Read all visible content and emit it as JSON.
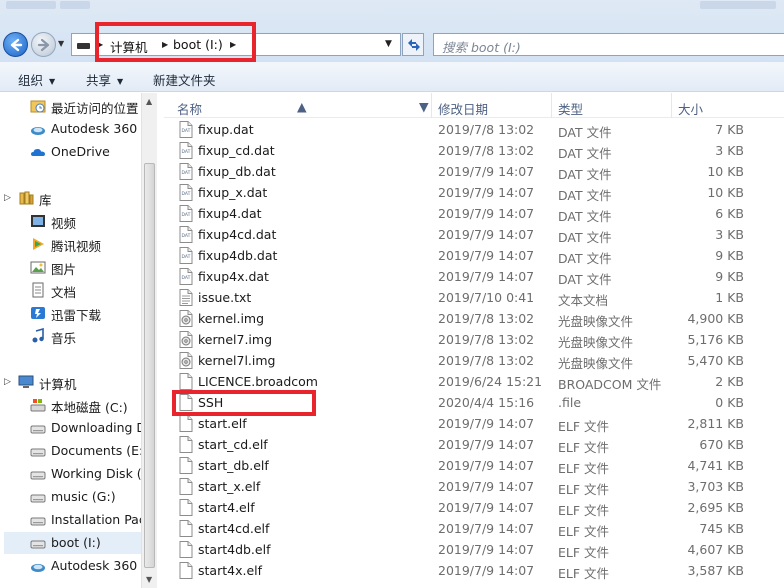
{
  "address": {
    "crumbs": [
      "计算机",
      "boot (I:)"
    ],
    "search_placeholder": "搜索 boot (I:)"
  },
  "toolbar": {
    "organize": "组织",
    "share": "共享",
    "new_folder": "新建文件夹"
  },
  "nav": {
    "items": [
      {
        "label": "最近访问的位置",
        "icon": "recent-places-icon"
      },
      {
        "label": "Autodesk 360",
        "icon": "autodesk-360-icon"
      },
      {
        "label": "OneDrive",
        "icon": "onedrive-cloud-icon"
      },
      {
        "label": "库",
        "icon": "library-icon"
      },
      {
        "label": "视频",
        "icon": "video-library-icon"
      },
      {
        "label": "腾讯视频",
        "icon": "tencent-video-icon"
      },
      {
        "label": "图片",
        "icon": "pictures-library-icon"
      },
      {
        "label": "文档",
        "icon": "documents-library-icon"
      },
      {
        "label": "迅雷下载",
        "icon": "thunder-download-icon"
      },
      {
        "label": "音乐",
        "icon": "music-library-icon"
      },
      {
        "label": "计算机",
        "icon": "computer-icon"
      },
      {
        "label": "本地磁盘 (C:)",
        "icon": "system-drive-icon"
      },
      {
        "label": "Downloading D",
        "icon": "drive-icon"
      },
      {
        "label": "Documents (E:)",
        "icon": "drive-icon"
      },
      {
        "label": "Working Disk (",
        "icon": "drive-icon"
      },
      {
        "label": "music (G:)",
        "icon": "drive-icon"
      },
      {
        "label": "Installation Pacl",
        "icon": "drive-icon"
      },
      {
        "label": "boot (I:)",
        "icon": "drive-icon",
        "selected": true
      },
      {
        "label": "Autodesk 360",
        "icon": "autodesk-360-icon"
      }
    ]
  },
  "columns": {
    "name": "名称",
    "date": "修改日期",
    "type": "类型",
    "size": "大小"
  },
  "files": [
    {
      "name": "fixup.dat",
      "date": "2019/7/8 13:02",
      "type": "DAT 文件",
      "size": "7 KB",
      "icon": "dat-file-icon"
    },
    {
      "name": "fixup_cd.dat",
      "date": "2019/7/8 13:02",
      "type": "DAT 文件",
      "size": "3 KB",
      "icon": "dat-file-icon"
    },
    {
      "name": "fixup_db.dat",
      "date": "2019/7/9 14:07",
      "type": "DAT 文件",
      "size": "10 KB",
      "icon": "dat-file-icon"
    },
    {
      "name": "fixup_x.dat",
      "date": "2019/7/9 14:07",
      "type": "DAT 文件",
      "size": "10 KB",
      "icon": "dat-file-icon"
    },
    {
      "name": "fixup4.dat",
      "date": "2019/7/9 14:07",
      "type": "DAT 文件",
      "size": "6 KB",
      "icon": "dat-file-icon"
    },
    {
      "name": "fixup4cd.dat",
      "date": "2019/7/9 14:07",
      "type": "DAT 文件",
      "size": "3 KB",
      "icon": "dat-file-icon"
    },
    {
      "name": "fixup4db.dat",
      "date": "2019/7/9 14:07",
      "type": "DAT 文件",
      "size": "9 KB",
      "icon": "dat-file-icon"
    },
    {
      "name": "fixup4x.dat",
      "date": "2019/7/9 14:07",
      "type": "DAT 文件",
      "size": "9 KB",
      "icon": "dat-file-icon"
    },
    {
      "name": "issue.txt",
      "date": "2019/7/10 0:41",
      "type": "文本文档",
      "size": "1 KB",
      "icon": "text-file-icon"
    },
    {
      "name": "kernel.img",
      "date": "2019/7/8 13:02",
      "type": "光盘映像文件",
      "size": "4,900 KB",
      "icon": "disc-image-icon"
    },
    {
      "name": "kernel7.img",
      "date": "2019/7/8 13:02",
      "type": "光盘映像文件",
      "size": "5,176 KB",
      "icon": "disc-image-icon"
    },
    {
      "name": "kernel7l.img",
      "date": "2019/7/8 13:02",
      "type": "光盘映像文件",
      "size": "5,470 KB",
      "icon": "disc-image-icon"
    },
    {
      "name": "LICENCE.broadcom",
      "date": "2019/6/24 15:21",
      "type": "BROADCOM 文件",
      "size": "2 KB",
      "icon": "blank-file-icon"
    },
    {
      "name": "SSH",
      "date": "2020/4/4 15:16",
      "type": ".file",
      "size": "0 KB",
      "icon": "blank-file-icon"
    },
    {
      "name": "start.elf",
      "date": "2019/7/9 14:07",
      "type": "ELF 文件",
      "size": "2,811 KB",
      "icon": "blank-file-icon"
    },
    {
      "name": "start_cd.elf",
      "date": "2019/7/9 14:07",
      "type": "ELF 文件",
      "size": "670 KB",
      "icon": "blank-file-icon"
    },
    {
      "name": "start_db.elf",
      "date": "2019/7/9 14:07",
      "type": "ELF 文件",
      "size": "4,741 KB",
      "icon": "blank-file-icon"
    },
    {
      "name": "start_x.elf",
      "date": "2019/7/9 14:07",
      "type": "ELF 文件",
      "size": "3,703 KB",
      "icon": "blank-file-icon"
    },
    {
      "name": "start4.elf",
      "date": "2019/7/9 14:07",
      "type": "ELF 文件",
      "size": "2,695 KB",
      "icon": "blank-file-icon"
    },
    {
      "name": "start4cd.elf",
      "date": "2019/7/9 14:07",
      "type": "ELF 文件",
      "size": "745 KB",
      "icon": "blank-file-icon"
    },
    {
      "name": "start4db.elf",
      "date": "2019/7/9 14:07",
      "type": "ELF 文件",
      "size": "4,607 KB",
      "icon": "blank-file-icon"
    },
    {
      "name": "start4x.elf",
      "date": "2019/7/9 14:07",
      "type": "ELF 文件",
      "size": "3,587 KB",
      "icon": "blank-file-icon"
    }
  ],
  "colors": {
    "highlight_box": "#e8242c",
    "header_text": "#4d6185",
    "selection_bg": "#e3eef9"
  }
}
